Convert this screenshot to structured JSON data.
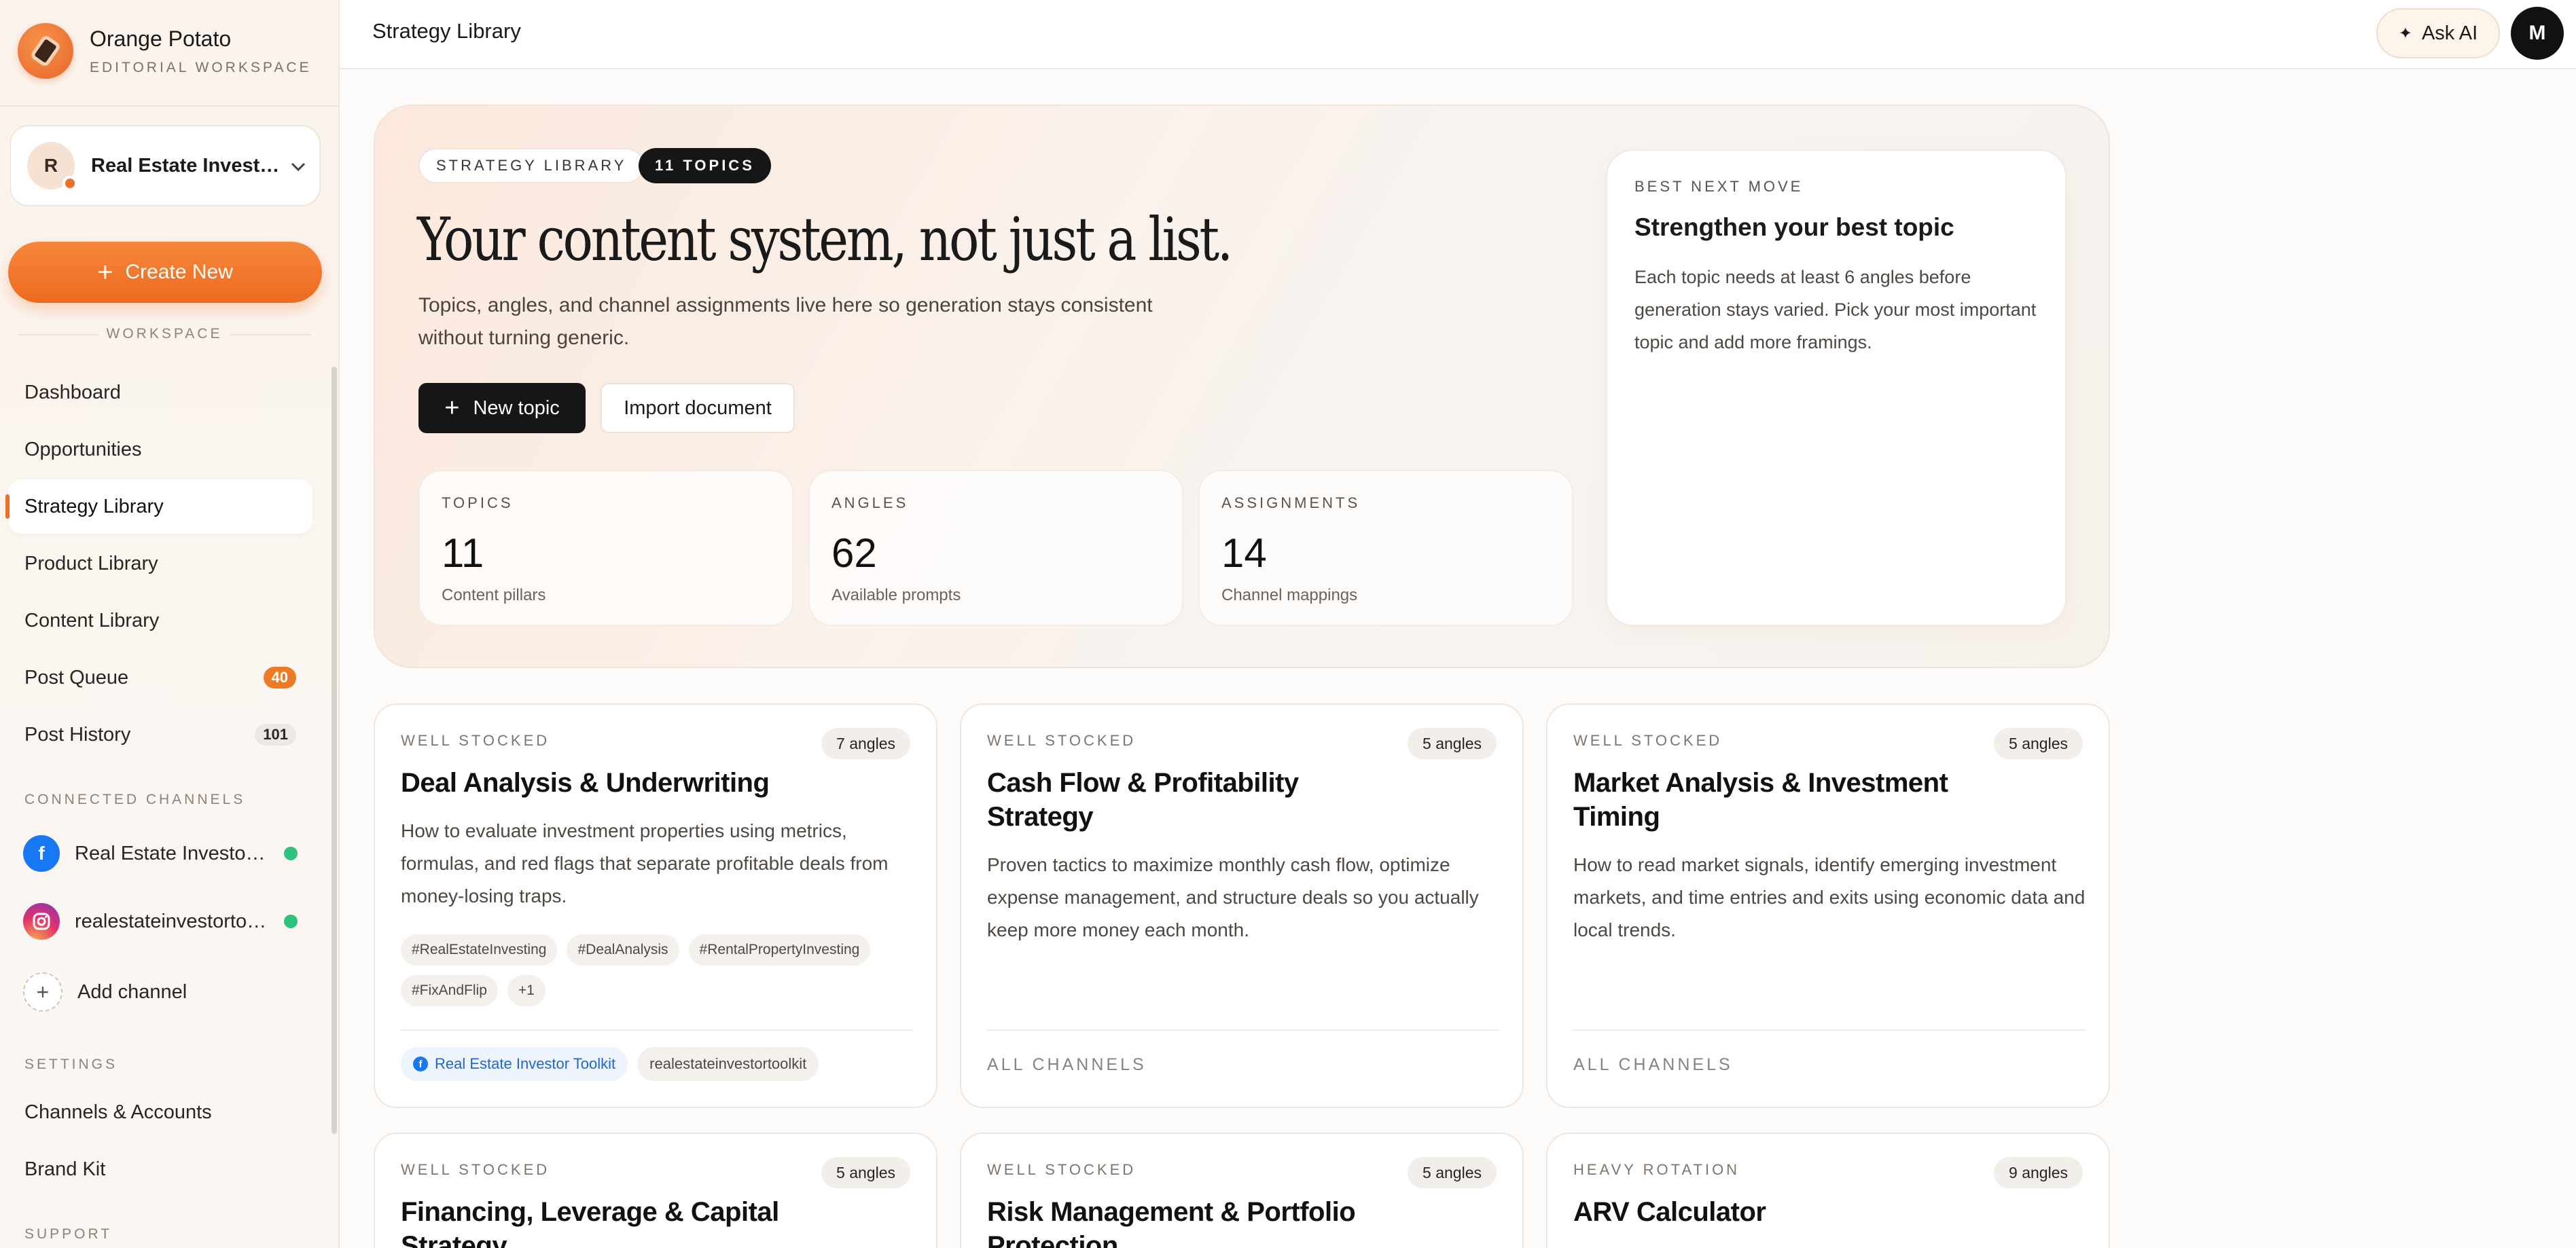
{
  "brand": {
    "name": "Orange Potato",
    "subtitle": "EDITORIAL WORKSPACE"
  },
  "workspace": {
    "avatar": "R",
    "name": "Real Estate Investor Toolkit"
  },
  "sidebar": {
    "create_label": "Create New",
    "workspace_section": "WORKSPACE",
    "nav": [
      {
        "label": "Dashboard"
      },
      {
        "label": "Opportunities"
      },
      {
        "label": "Strategy Library"
      },
      {
        "label": "Product Library"
      },
      {
        "label": "Content Library"
      },
      {
        "label": "Post Queue",
        "badge": "40"
      },
      {
        "label": "Post History",
        "badge": "101"
      }
    ],
    "channels_section": "CONNECTED CHANNELS",
    "channels": [
      {
        "name": "Real Estate Investor Toolkit",
        "icon": "facebook-icon"
      },
      {
        "name": "realestateinvestortoolkit",
        "icon": "instagram-icon"
      }
    ],
    "add_channel": "Add channel",
    "settings_section": "SETTINGS",
    "settings": [
      {
        "label": "Channels & Accounts"
      },
      {
        "label": "Brand Kit"
      }
    ],
    "support_section": "SUPPORT"
  },
  "topbar": {
    "title": "Strategy Library",
    "ask_ai": "Ask AI",
    "user_initial": "M"
  },
  "hero": {
    "pill_library": "STRATEGY LIBRARY",
    "pill_topics": "11 TOPICS",
    "title": "Your content system, not just a list.",
    "description": "Topics, angles, and channel assignments live here so generation stays consistent without turning generic.",
    "new_topic": "New topic",
    "import_document": "Import document",
    "stats": [
      {
        "label": "TOPICS",
        "value": "11",
        "sub": "Content pillars"
      },
      {
        "label": "ANGLES",
        "value": "62",
        "sub": "Available prompts"
      },
      {
        "label": "ASSIGNMENTS",
        "value": "14",
        "sub": "Channel mappings"
      }
    ],
    "next_move": {
      "label": "BEST NEXT MOVE",
      "title": "Strengthen your best topic",
      "description": "Each topic needs at least 6 angles before generation stays varied. Pick your most important topic and add more framings."
    }
  },
  "topics": [
    {
      "status": "WELL STOCKED",
      "angles": "7 angles",
      "title": "Deal Analysis & Underwriting",
      "description": "How to evaluate investment properties using metrics, formulas, and red flags that separate profitable deals from money-losing traps.",
      "tags": [
        "#RealEstateInvesting",
        "#DealAnalysis",
        "#RentalPropertyInvesting",
        "#FixAndFlip",
        "+1"
      ],
      "channels": [
        "Real Estate Investor Toolkit",
        "realestateinvestortoolkit"
      ]
    },
    {
      "status": "WELL STOCKED",
      "angles": "5 angles",
      "title": "Cash Flow & Profitability Strategy",
      "description": "Proven tactics to maximize monthly cash flow, optimize expense management, and structure deals so you actually keep more money each month.",
      "footer": "ALL CHANNELS"
    },
    {
      "status": "WELL STOCKED",
      "angles": "5 angles",
      "title": "Market Analysis & Investment Timing",
      "description": "How to read market signals, identify emerging investment markets, and time entries and exits using economic data and local trends.",
      "footer": "ALL CHANNELS"
    },
    {
      "status": "WELL STOCKED",
      "angles": "5 angles",
      "title": "Financing, Leverage & Capital Strategy"
    },
    {
      "status": "WELL STOCKED",
      "angles": "5 angles",
      "title": "Risk Management & Portfolio Protection"
    },
    {
      "status": "HEAVY ROTATION",
      "angles": "9 angles",
      "title": "ARV Calculator"
    }
  ]
}
